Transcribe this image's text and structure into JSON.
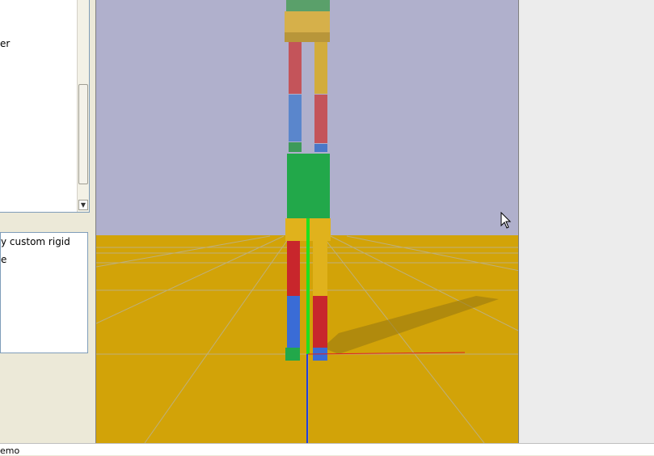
{
  "tree": {
    "items": [
      {
        "label": "er"
      }
    ]
  },
  "description": {
    "lines": [
      "y custom rigid",
      "e"
    ]
  },
  "status": {
    "text": "emo"
  },
  "colors": {
    "sky": "#b0b0cc",
    "floor": "#d2a308",
    "body_red": "#c8262c",
    "body_blue": "#3a6cd6",
    "body_green": "#22a84a",
    "body_yellow": "#e0b21c",
    "axis_x": "#e02020",
    "axis_y": "#20e020",
    "axis_z": "#2040e0"
  },
  "icons": {
    "scroll_down": "triangle-down",
    "cursor": "arrow-pointer"
  }
}
